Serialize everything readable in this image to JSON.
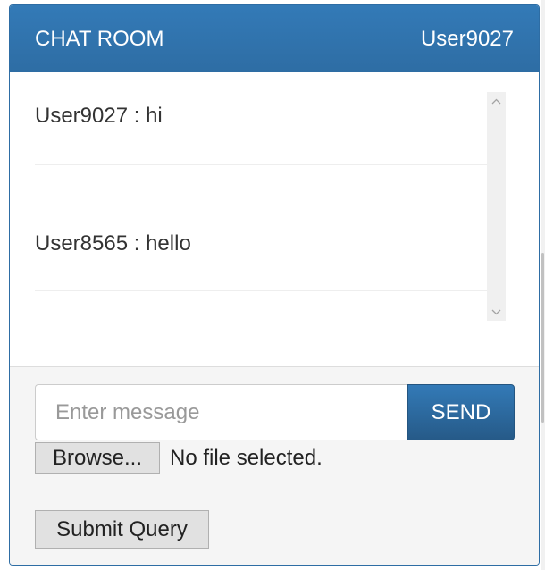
{
  "header": {
    "title": "CHAT ROOM",
    "username": "User9027"
  },
  "messages": [
    {
      "user": "User9027",
      "separator": " : ",
      "text": "hi"
    },
    {
      "user": "User8565",
      "separator": " : ",
      "text": "hello"
    }
  ],
  "composer": {
    "placeholder": "Enter message",
    "value": "",
    "send_label": "SEND"
  },
  "file_upload": {
    "browse_label": "Browse...",
    "status": "No file selected."
  },
  "submit_label": "Submit Query",
  "colors": {
    "primary": "#337ab7",
    "footer_bg": "#f5f5f5"
  },
  "icons": {
    "scroll_up": "chevron-up-icon",
    "scroll_down": "chevron-down-icon"
  }
}
